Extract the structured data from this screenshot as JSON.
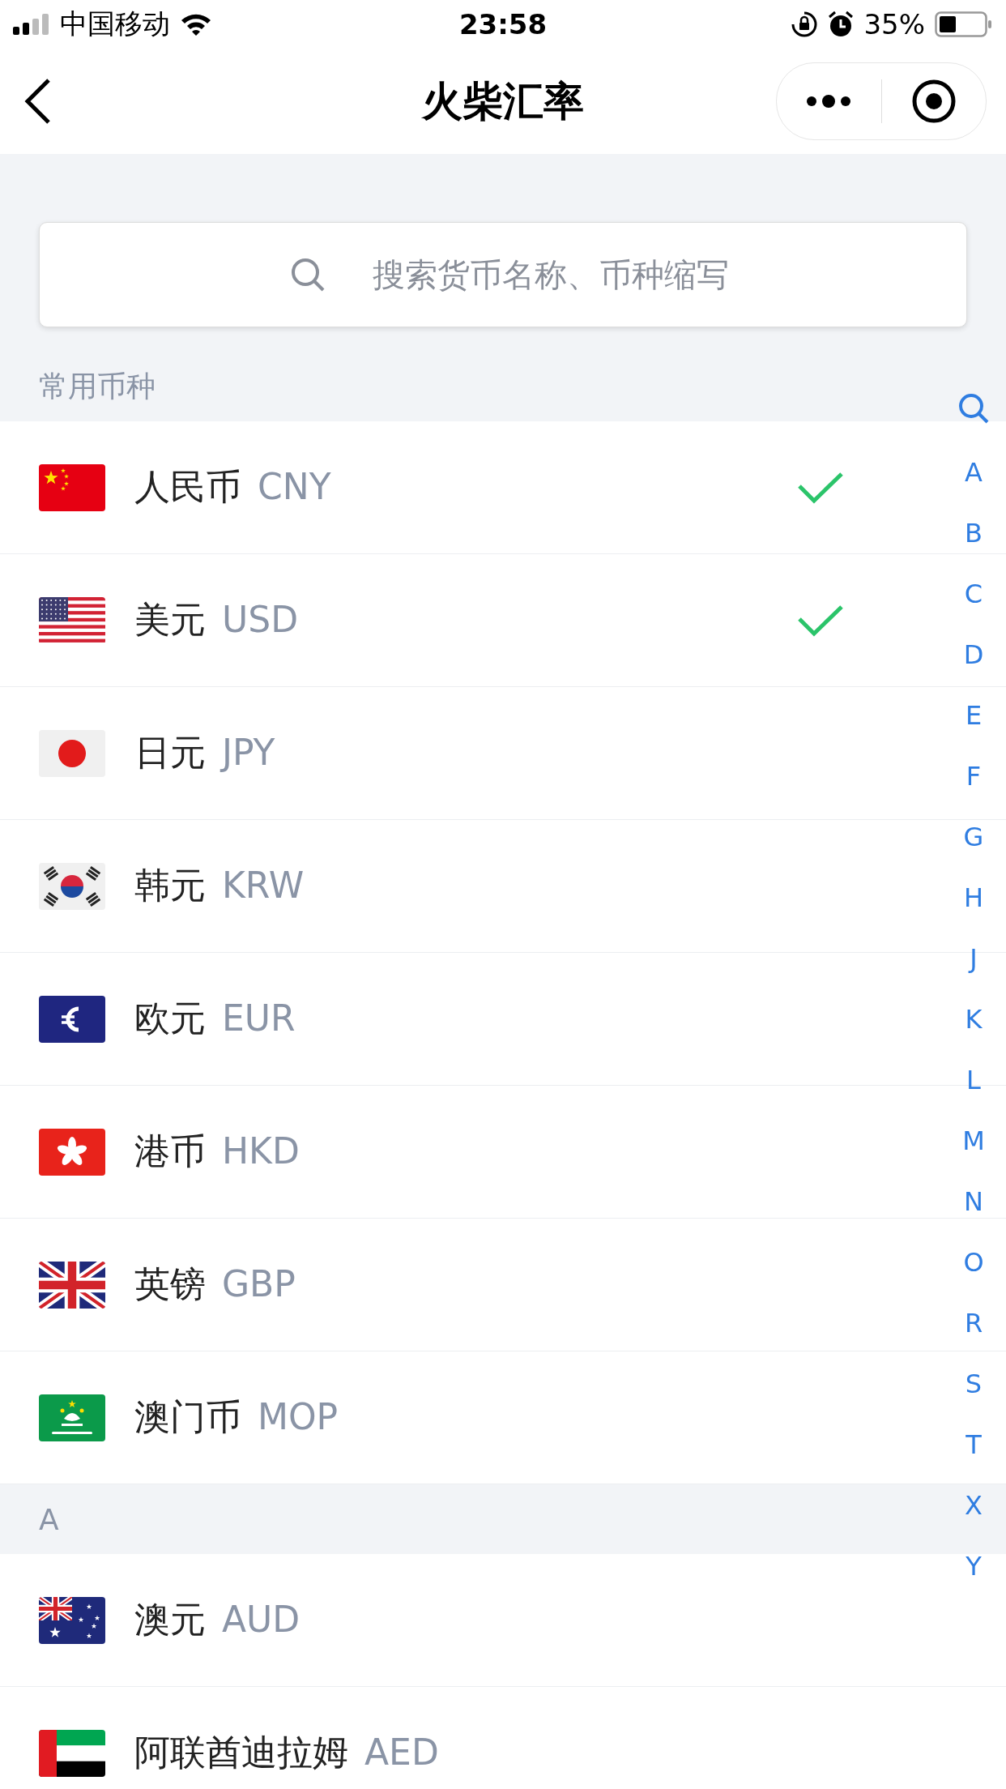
{
  "status_bar": {
    "carrier": "中国移动",
    "time": "23:58",
    "battery_text": "35%"
  },
  "nav": {
    "title": "火柴汇率"
  },
  "search": {
    "placeholder": "搜索货币名称、币种缩写"
  },
  "sections": [
    {
      "title": "常用币种",
      "items": [
        {
          "name": "人民币",
          "code": "CNY",
          "kind": "cn",
          "checked": true
        },
        {
          "name": "美元",
          "code": "USD",
          "kind": "us",
          "checked": true
        },
        {
          "name": "日元",
          "code": "JPY",
          "kind": "jp",
          "checked": false
        },
        {
          "name": "韩元",
          "code": "KRW",
          "kind": "kr",
          "checked": false
        },
        {
          "name": "欧元",
          "code": "EUR",
          "kind": "eu",
          "checked": false
        },
        {
          "name": "港币",
          "code": "HKD",
          "kind": "hk",
          "checked": false
        },
        {
          "name": "英镑",
          "code": "GBP",
          "kind": "gb",
          "checked": false
        },
        {
          "name": "澳门币",
          "code": "MOP",
          "kind": "mo",
          "checked": false
        }
      ]
    },
    {
      "title": "A",
      "items": [
        {
          "name": "澳元",
          "code": "AUD",
          "kind": "au",
          "checked": false
        },
        {
          "name": "阿联酋迪拉姆",
          "code": "AED",
          "kind": "ae",
          "checked": false
        }
      ]
    }
  ],
  "index": [
    "A",
    "B",
    "C",
    "D",
    "E",
    "F",
    "G",
    "H",
    "J",
    "K",
    "L",
    "M",
    "N",
    "O",
    "R",
    "S",
    "T",
    "X",
    "Y"
  ]
}
